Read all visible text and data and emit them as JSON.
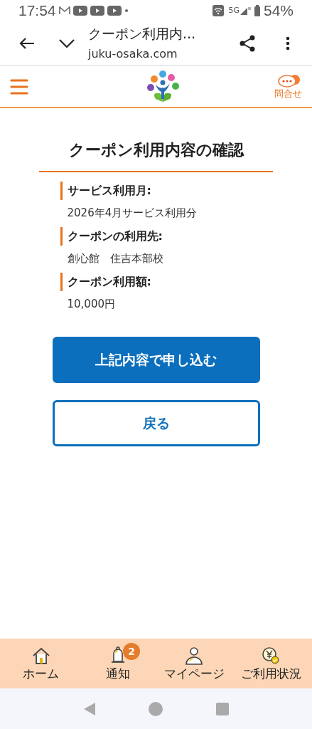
{
  "status_bar": {
    "time": "17:54",
    "network": "5G",
    "battery": "54%"
  },
  "browser": {
    "title": "クーポン利用内...",
    "url": "juku-osaka.com"
  },
  "header": {
    "contact_label": "問合せ"
  },
  "page": {
    "title": "クーポン利用内容の確認",
    "fields": [
      {
        "label": "サービス利用月:",
        "value": "2026年4月サービス利用分"
      },
      {
        "label": "クーポンの利用先:",
        "value": "創心館　住吉本部校"
      },
      {
        "label": "クーポン利用額:",
        "value": "10,000円"
      }
    ],
    "buttons": [
      {
        "kind": "primary",
        "label": "上記内容で申し込む"
      },
      {
        "kind": "outline",
        "label": "戻る"
      }
    ]
  },
  "bottom_nav": [
    {
      "kind": "home",
      "label": "ホーム"
    },
    {
      "kind": "bell",
      "label": "通知",
      "badge": "2"
    },
    {
      "kind": "person",
      "label": "マイページ"
    },
    {
      "kind": "yen",
      "label": "ご利用状況"
    }
  ]
}
